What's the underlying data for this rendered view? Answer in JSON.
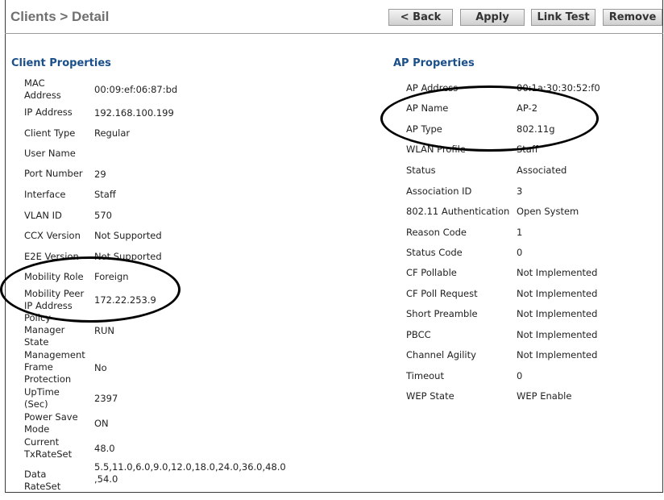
{
  "header": {
    "title": "Clients > Detail",
    "buttons": {
      "back": "< Back",
      "apply": "Apply",
      "link_test": "Link Test",
      "remove": "Remove"
    }
  },
  "client_properties": {
    "title": "Client Properties",
    "rows": [
      {
        "label": "MAC Address",
        "value": "00:09:ef:06:87:bd"
      },
      {
        "label": "IP Address",
        "value": "192.168.100.199"
      },
      {
        "label": "Client Type",
        "value": "Regular"
      },
      {
        "label": "User Name",
        "value": ""
      },
      {
        "label": "Port Number",
        "value": "29"
      },
      {
        "label": "Interface",
        "value": "Staff"
      },
      {
        "label": "VLAN ID",
        "value": "570"
      },
      {
        "label": "CCX Version",
        "value": "Not Supported"
      },
      {
        "label": "E2E Version",
        "value": "Not Supported"
      },
      {
        "label": "Mobility Role",
        "value": "Foreign"
      },
      {
        "label": "Mobility Peer IP Address",
        "value": "172.22.253.9"
      },
      {
        "label": "Policy Manager State",
        "value": "RUN"
      },
      {
        "label": "Management Frame Protection",
        "value": "No"
      },
      {
        "label": "UpTime (Sec)",
        "value": "2397"
      },
      {
        "label": "Power Save Mode",
        "value": "ON"
      },
      {
        "label": "Current TxRateSet",
        "value": "48.0"
      },
      {
        "label": "Data RateSet",
        "value": "5.5,11.0,6.0,9.0,12.0,18.0,24.0,36.0,48.0 ,54.0"
      }
    ]
  },
  "ap_properties": {
    "title": "AP Properties",
    "rows": [
      {
        "label": "AP Address",
        "value": "00:1a:30:30:52:f0"
      },
      {
        "label": "AP Name",
        "value": "AP-2"
      },
      {
        "label": "AP Type",
        "value": "802.11g"
      },
      {
        "label": "WLAN Profile",
        "value": "Staff"
      },
      {
        "label": "Status",
        "value": "Associated"
      },
      {
        "label": "Association ID",
        "value": "3"
      },
      {
        "label": "802.11 Authentication",
        "value": "Open System"
      },
      {
        "label": "Reason Code",
        "value": "1"
      },
      {
        "label": "Status Code",
        "value": "0"
      },
      {
        "label": "CF Pollable",
        "value": "Not Implemented"
      },
      {
        "label": "CF Poll Request",
        "value": "Not Implemented"
      },
      {
        "label": "Short Preamble",
        "value": "Not Implemented"
      },
      {
        "label": "PBCC",
        "value": "Not Implemented"
      },
      {
        "label": "Channel Agility",
        "value": "Not Implemented"
      },
      {
        "label": "Timeout",
        "value": "0"
      },
      {
        "label": "WEP State",
        "value": "WEP Enable"
      }
    ]
  }
}
